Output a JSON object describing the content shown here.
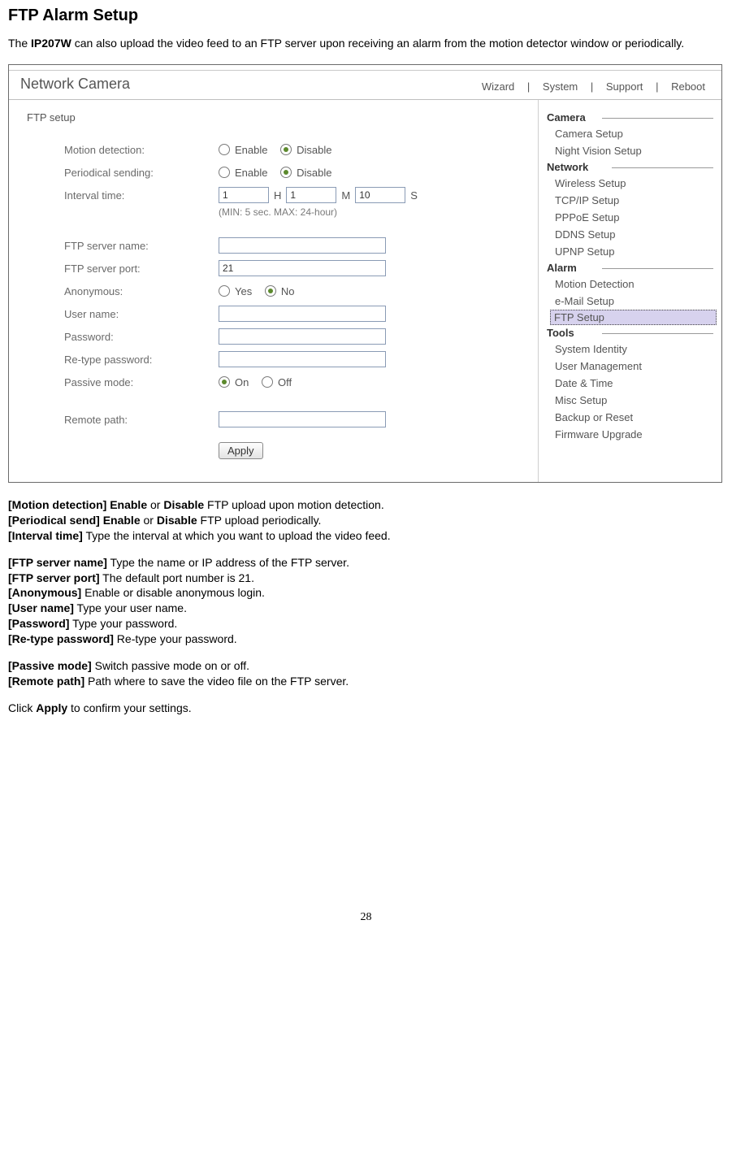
{
  "doc": {
    "heading": "FTP Alarm Setup",
    "intro_pre": "The ",
    "intro_model": "IP207W",
    "intro_post": " can also upload the video feed to an FTP server upon receiving an alarm from the motion detector window or periodically.",
    "page_number": "28"
  },
  "ui": {
    "brand": "Network Camera",
    "toplinks": {
      "wizard": "Wizard",
      "system": "System",
      "support": "Support",
      "reboot": "Reboot",
      "sep": "|"
    },
    "section_title": "FTP setup",
    "labels": {
      "motion": "Motion detection:",
      "periodical": "Periodical sending:",
      "interval": "Interval time:",
      "h": "H",
      "m": "M",
      "s": "S",
      "interval_hint": "(MIN: 5 sec. MAX: 24-hour)",
      "server_name": "FTP server name:",
      "server_port": "FTP server port:",
      "anonymous": "Anonymous:",
      "yes": "Yes",
      "no": "No",
      "enable": "Enable",
      "disable": "Disable",
      "user": "User name:",
      "password": "Password:",
      "repassword": "Re-type password:",
      "passive": "Passive mode:",
      "on": "On",
      "off": "Off",
      "remote": "Remote path:",
      "apply": "Apply"
    },
    "values": {
      "interval_h": "1",
      "interval_m": "1",
      "interval_s": "10",
      "server_name": "",
      "server_port": "21",
      "user": "",
      "password": "",
      "repassword": "",
      "remote": ""
    },
    "sidebar": {
      "camera_hdr": "Camera",
      "camera": [
        "Camera Setup",
        "Night Vision Setup"
      ],
      "network_hdr": "Network",
      "network": [
        "Wireless Setup",
        "TCP/IP Setup",
        "PPPoE Setup",
        "DDNS Setup",
        "UPNP Setup"
      ],
      "alarm_hdr": "Alarm",
      "alarm": [
        "Motion Detection",
        "e-Mail Setup",
        "FTP Setup"
      ],
      "tools_hdr": "Tools",
      "tools": [
        "System Identity",
        "User Management",
        "Date & Time",
        "Misc Setup",
        "Backup or Reset",
        "Firmware Upgrade"
      ]
    }
  },
  "desc": {
    "l1a": "[Motion detection] Enable",
    "l1b": " or ",
    "l1c": "Disable",
    "l1d": " FTP upload upon motion detection.",
    "l2a": "[Periodical send] Enable",
    "l2b": " or ",
    "l2c": "Disable",
    "l2d": " FTP upload periodically.",
    "l3a": "[Interval time]",
    "l3b": " Type the interval at which you want to upload the video feed.",
    "l4a": "[FTP server name]",
    "l4b": " Type the name or IP address of the FTP server.",
    "l5a": "[FTP server port]",
    "l5b": " The default port number is 21.",
    "l6a": "[Anonymous]",
    "l6b": " Enable or disable anonymous login.",
    "l7a": "[User name]",
    "l7b": " Type your user name.",
    "l8a": "[Password]",
    "l8b": " Type your password.",
    "l9a": "[Re-type password]",
    "l9b": " Re-type your password.",
    "l10a": "[Passive mode]",
    "l10b": " Switch passive mode on or off.",
    "l11a": "[Remote path]",
    "l11b": " Path where to save the video file on the FTP server.",
    "l12a": "Click ",
    "l12b": "Apply",
    "l12c": " to confirm your settings."
  }
}
